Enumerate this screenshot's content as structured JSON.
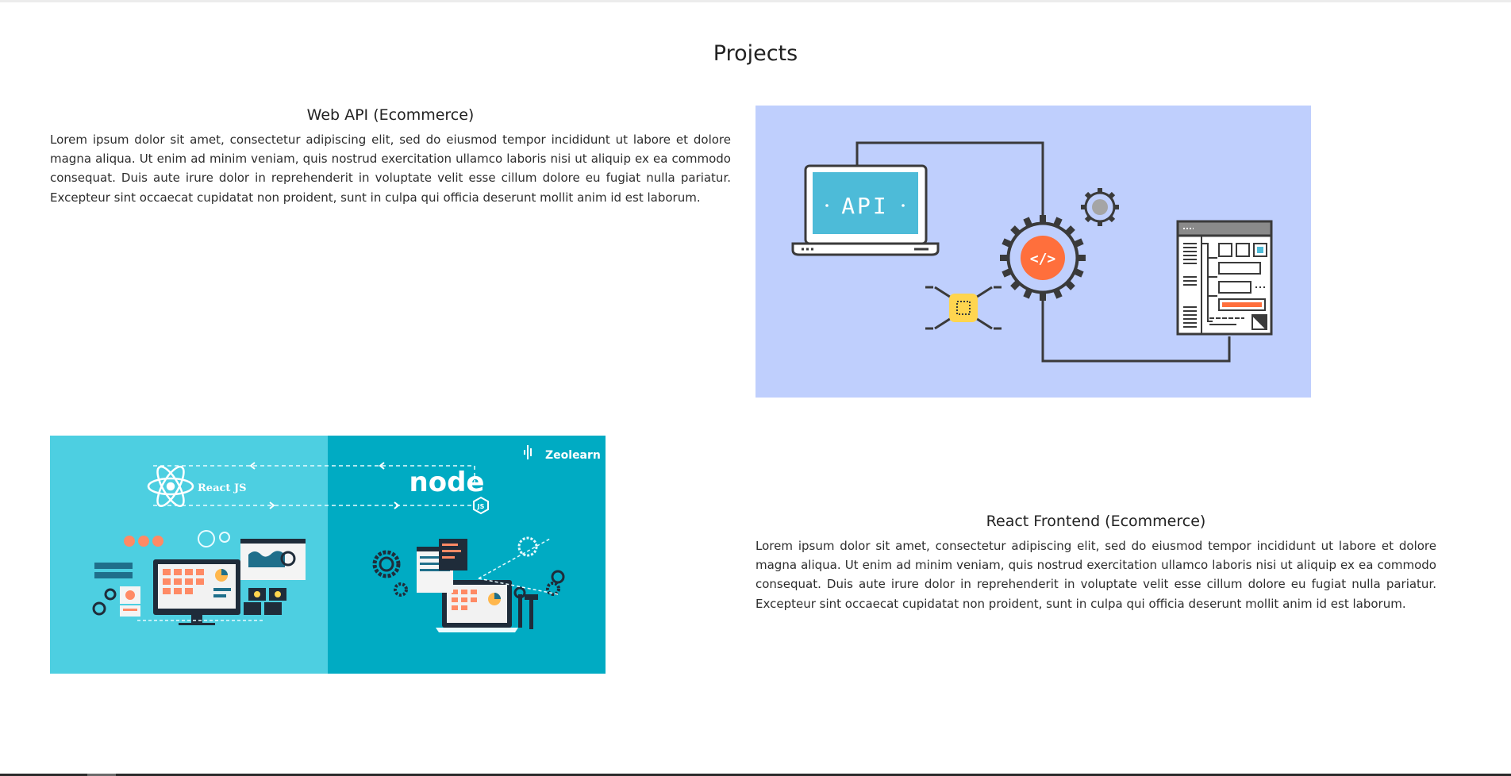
{
  "section": {
    "title": "Projects"
  },
  "projects": [
    {
      "title": "Web API (Ecommerce)",
      "description": "Lorem ipsum dolor sit amet, consectetur adipiscing elit, sed do eiusmod tempor incididunt ut labore et dolore magna aliqua. Ut enim ad minim veniam, quis nostrud exercitation ullamco laboris nisi ut aliquip ex ea commodo consequat. Duis aute irure dolor in reprehenderit in voluptate velit esse cillum dolore eu fugiat nulla pariatur. Excepteur sint occaecat cupidatat non proident, sunt in culpa qui officia deserunt mollit anim id est laborum.",
      "image": {
        "screen_label": "API",
        "bg_color": "#bfcffd"
      }
    },
    {
      "title": "React Frontend (Ecommerce)",
      "description": "Lorem ipsum dolor sit amet, consectetur adipiscing elit, sed do eiusmod tempor incididunt ut labore et dolore magna aliqua. Ut enim ad minim veniam, quis nostrud exercitation ullamco laboris nisi ut aliquip ex ea commodo consequat. Duis aute irure dolor in reprehenderit in voluptate velit esse cillum dolore eu fugiat nulla pariatur. Excepteur sint occaecat cupidatat non proident, sunt in culpa qui officia deserunt mollit anim id est laborum.",
      "image": {
        "react_label": "React JS",
        "node_label": "node",
        "js_label": "JS",
        "brand": "Zeolearn",
        "left_bg": "#4dcfe1",
        "right_bg": "#00abc3"
      }
    }
  ]
}
